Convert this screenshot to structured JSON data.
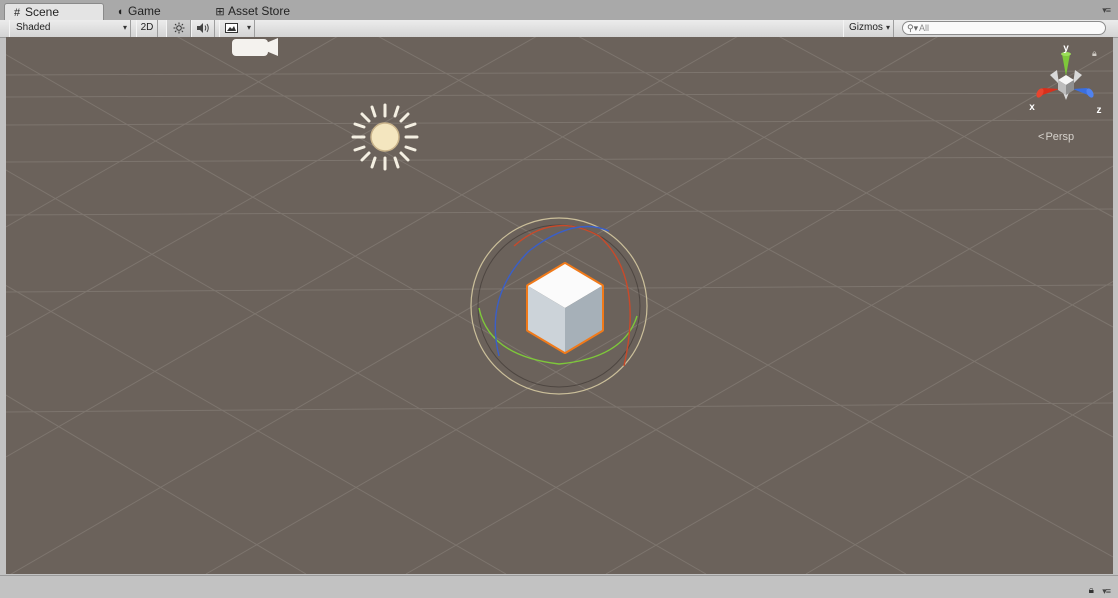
{
  "tabs": [
    {
      "label": "Scene",
      "icon": "grid-icon",
      "active": true
    },
    {
      "label": "Game",
      "icon": "pacman-icon",
      "active": false
    },
    {
      "label": "Asset Store",
      "icon": "shopping-bag-icon",
      "active": false
    }
  ],
  "toolbar": {
    "shading_mode": "Shaded",
    "toggle_2d": "2D",
    "lighting_icon": "sun-icon",
    "audio_icon": "speaker-icon",
    "effects_icon": "image-icon",
    "gizmos_label": "Gizmos",
    "search_placeholder": "All"
  },
  "scene": {
    "background_color": "#6b625b",
    "selection_outline_color": "#f07a1a",
    "gizmo": {
      "axes": {
        "x": "x",
        "y": "y",
        "z": "z"
      },
      "x_color": "#d8301c",
      "y_color": "#7ec83a",
      "z_color": "#3a6fe0",
      "projection_label": "Persp"
    }
  }
}
